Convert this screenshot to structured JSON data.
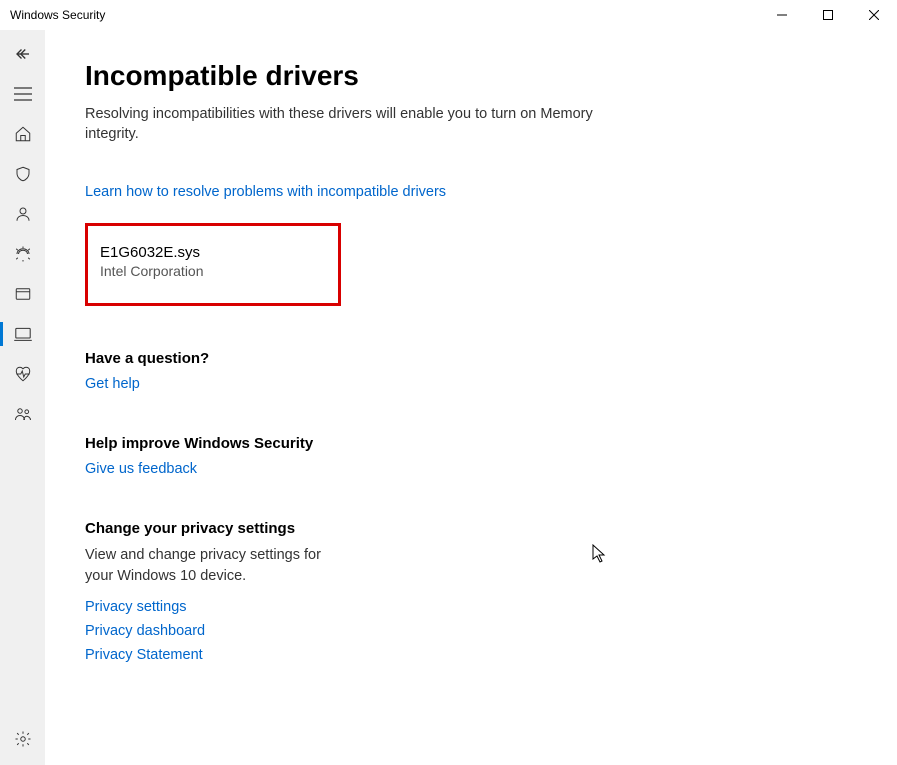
{
  "titlebar": {
    "title": "Windows Security"
  },
  "page": {
    "title": "Incompatible drivers",
    "description": "Resolving incompatibilities with these drivers will enable you to turn on Memory integrity.",
    "learn_link": "Learn how to resolve problems with incompatible drivers"
  },
  "driver": {
    "name": "E1G6032E.sys",
    "vendor": "Intel Corporation"
  },
  "question": {
    "title": "Have a question?",
    "help_link": "Get help"
  },
  "improve": {
    "title": "Help improve Windows Security",
    "feedback_link": "Give us feedback"
  },
  "privacy": {
    "title": "Change your privacy settings",
    "description": "View and change privacy settings for your Windows 10 device.",
    "links": {
      "settings": "Privacy settings",
      "dashboard": "Privacy dashboard",
      "statement": "Privacy Statement"
    }
  }
}
